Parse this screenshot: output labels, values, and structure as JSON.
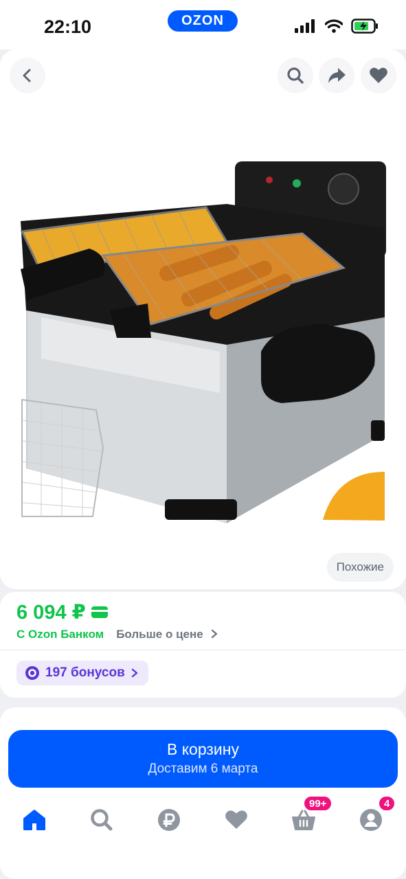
{
  "status_bar": {
    "time": "22:10",
    "brand": "OZON"
  },
  "product": {
    "similar_label": "Похожие",
    "price": "6 094 ₽",
    "bank_label": "С Ozon Банком",
    "more_price_label": "Больше о цене",
    "bonus_label": "197 бонусов"
  },
  "cart_button": {
    "title": "В корзину",
    "subtitle": "Доставим 6 марта"
  },
  "tab_bar": {
    "cart_badge": "99+",
    "profile_badge": "4"
  },
  "colors": {
    "accent": "#005bff",
    "price": "#10c44c",
    "badge": "#f1117e",
    "bonus": "#5a35d8"
  },
  "icons": [
    "back-arrow-icon",
    "search-icon",
    "share-icon",
    "heart-icon",
    "card-icon",
    "chevron-right-icon",
    "bonus-icon",
    "home-icon",
    "ruble-icon",
    "cart-icon",
    "profile-icon",
    "signal-icon",
    "wifi-icon",
    "battery-icon"
  ]
}
